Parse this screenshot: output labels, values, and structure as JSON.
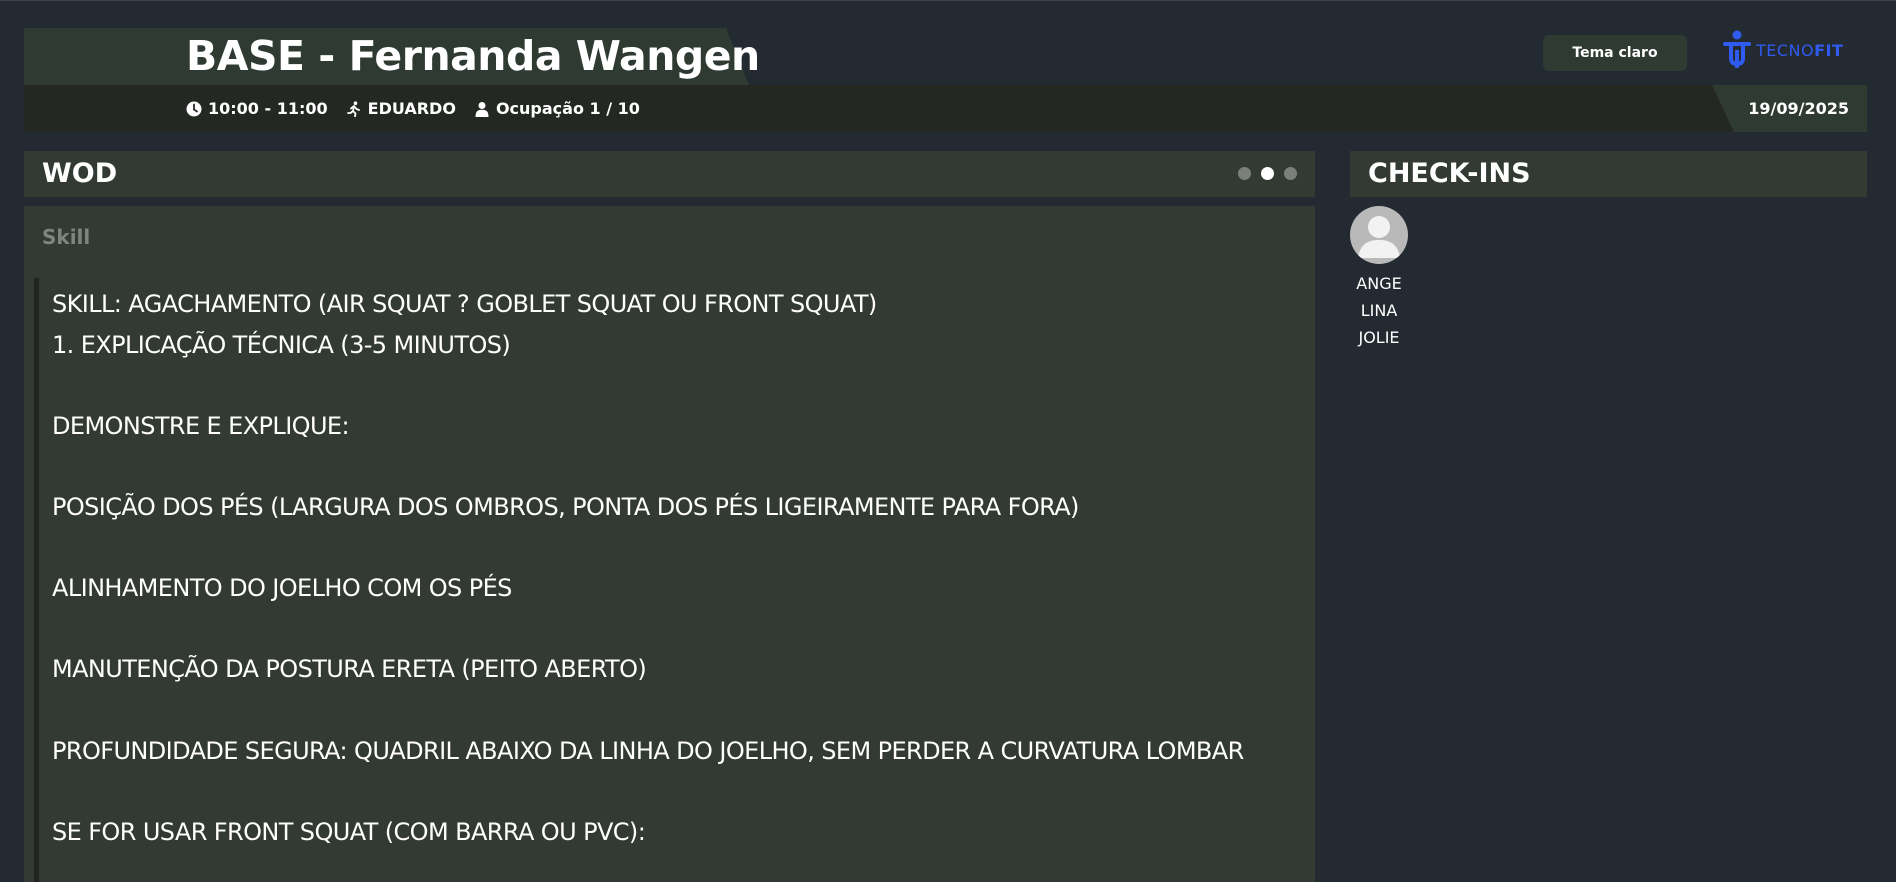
{
  "header": {
    "title": "BASE - Fernanda Wangen",
    "time": "10:00 - 11:00",
    "coach": "EDUARDO",
    "occupancy": "Ocupação 1 / 10",
    "date": "19/09/2025",
    "theme_button": "Tema claro",
    "logo": {
      "part1": "TECNO",
      "part2": "FIT",
      "color": "#2f5bf0"
    }
  },
  "wod": {
    "title": "WOD",
    "active_dot_index": 1,
    "section_label": "Skill",
    "lines": [
      "SKILL: AGACHAMENTO (AIR SQUAT ? GOBLET SQUAT OU FRONT SQUAT)",
      "1. EXPLICAÇÃO TÉCNICA (3-5 MINUTOS)",
      "",
      "DEMONSTRE E EXPLIQUE:",
      "",
      "POSIÇÃO DOS PÉS (LARGURA DOS OMBROS, PONTA DOS PÉS LIGEIRAMENTE PARA FORA)",
      "",
      "ALINHAMENTO DO JOELHO COM OS PÉS",
      "",
      "MANUTENÇÃO DA POSTURA ERETA (PEITO ABERTO)",
      "",
      "PROFUNDIDADE SEGURA: QUADRIL ABAIXO DA LINHA DO JOELHO, SEM PERDER A CURVATURA LOMBAR",
      "",
      "SE FOR USAR FRONT SQUAT (COM BARRA OU PVC):"
    ]
  },
  "checkins": {
    "title": "CHECK-INS",
    "people": [
      {
        "name_lines": [
          "ANGE",
          "LINA",
          "JOLIE"
        ]
      }
    ]
  }
}
